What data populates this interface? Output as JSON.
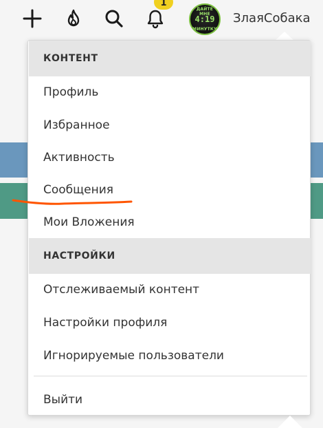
{
  "topbar": {
    "icons": {
      "add": "plus-icon",
      "hot": "fire-icon",
      "search": "search-icon",
      "alerts": "bell-icon"
    },
    "alerts_badge": "1",
    "avatar": {
      "top_text": "ДАЙТЕ МНЕ",
      "clock": "4:19",
      "bottom_text": "МИНУТКУ"
    },
    "username": "ЗлаяСобака"
  },
  "menu": {
    "sections": [
      {
        "header": "КОНТЕНТ",
        "items": [
          "Профиль",
          "Избранное",
          "Активность",
          "Сообщения",
          "Мои Вложения"
        ]
      },
      {
        "header": "НАСТРОЙКИ",
        "items": [
          "Отслеживаемый контент",
          "Настройки профиля",
          "Игнорируемые пользователи"
        ]
      }
    ],
    "logout": "Выйти"
  },
  "colors": {
    "annotation_underline": "#ff5500",
    "section_header_bg": "#e5e5e5",
    "badge": "#f0d020",
    "strip_blue": "#6a97bd",
    "strip_green": "#4f9a85"
  }
}
